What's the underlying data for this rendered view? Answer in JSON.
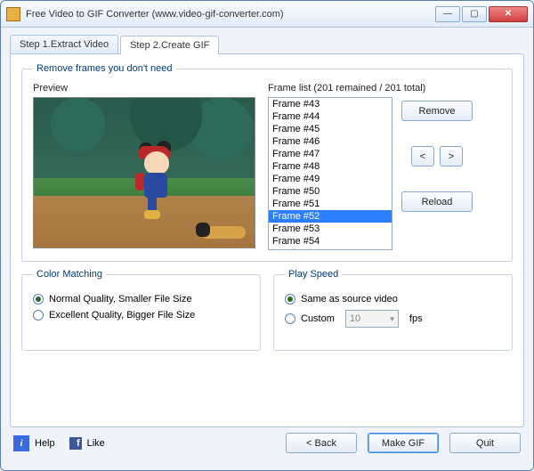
{
  "window": {
    "title": "Free Video to GIF Converter (www.video-gif-converter.com)"
  },
  "tabs": {
    "step1": "Step 1.Extract Video",
    "step2": "Step 2.Create GIF"
  },
  "frames_group": {
    "legend": "Remove frames you don't need",
    "preview_label": "Preview",
    "framelist_label": "Frame list (201 remained / 201 total)",
    "remove_btn": "Remove",
    "prev_btn": "<",
    "next_btn": ">",
    "reload_btn": "Reload",
    "items": [
      "Frame #43",
      "Frame #44",
      "Frame #45",
      "Frame #46",
      "Frame #47",
      "Frame #48",
      "Frame #49",
      "Frame #50",
      "Frame #51",
      "Frame #52",
      "Frame #53",
      "Frame #54"
    ],
    "selected_index": 9
  },
  "color_matching": {
    "legend": "Color Matching",
    "normal": "Normal Quality, Smaller File Size",
    "excellent": "Excellent Quality, Bigger File Size",
    "selected": "normal"
  },
  "play_speed": {
    "legend": "Play Speed",
    "same": "Same as source video",
    "custom": "Custom",
    "custom_value": "10",
    "unit": "fps",
    "selected": "same"
  },
  "footer": {
    "help": "Help",
    "like": "Like",
    "back": "< Back",
    "make": "Make GIF",
    "quit": "Quit"
  }
}
